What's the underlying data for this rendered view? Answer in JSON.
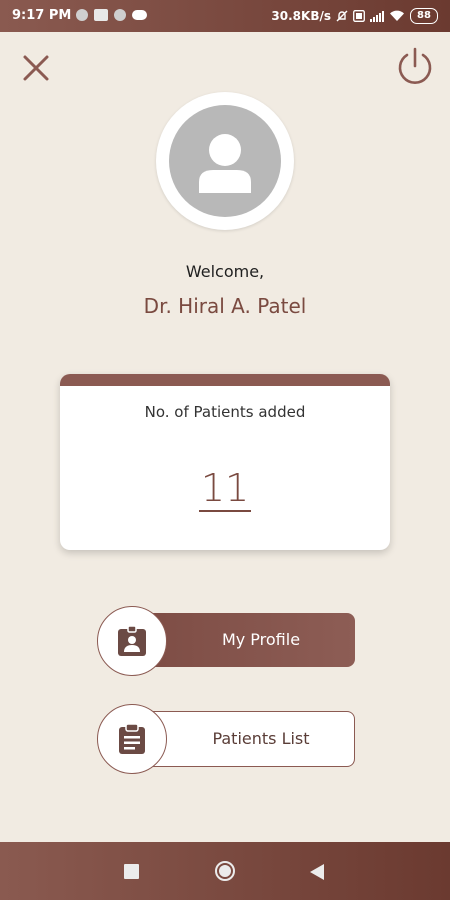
{
  "status_bar": {
    "time": "9:17 PM",
    "network_speed": "30.8KB/s",
    "battery": "88",
    "icons": [
      "notification-dot-icon",
      "message-icon",
      "notification-dot-icon",
      "cloud-icon",
      "mute-icon",
      "hd-icon",
      "signal-icon",
      "wifi-icon",
      "battery-icon"
    ]
  },
  "header": {
    "close_icon": "close-icon",
    "power_icon": "power-icon"
  },
  "profile": {
    "avatar_icon": "user-avatar-icon",
    "welcome_text": "Welcome,",
    "doctor_name": "Dr. Hiral A. Patel"
  },
  "stats_card": {
    "title": "No. of Patients added",
    "count": "11"
  },
  "actions": {
    "my_profile_label": "My Profile",
    "my_profile_icon": "profile-badge-icon",
    "patients_list_label": "Patients List",
    "patients_list_icon": "clipboard-icon"
  },
  "navigation": {
    "items": [
      "recents-icon",
      "home-icon",
      "back-icon"
    ]
  },
  "colors": {
    "accent": "#8b5a52",
    "background": "#f1ebe2",
    "bar_gradient_start": "#8a5a50",
    "bar_gradient_end": "#6b3a30"
  }
}
